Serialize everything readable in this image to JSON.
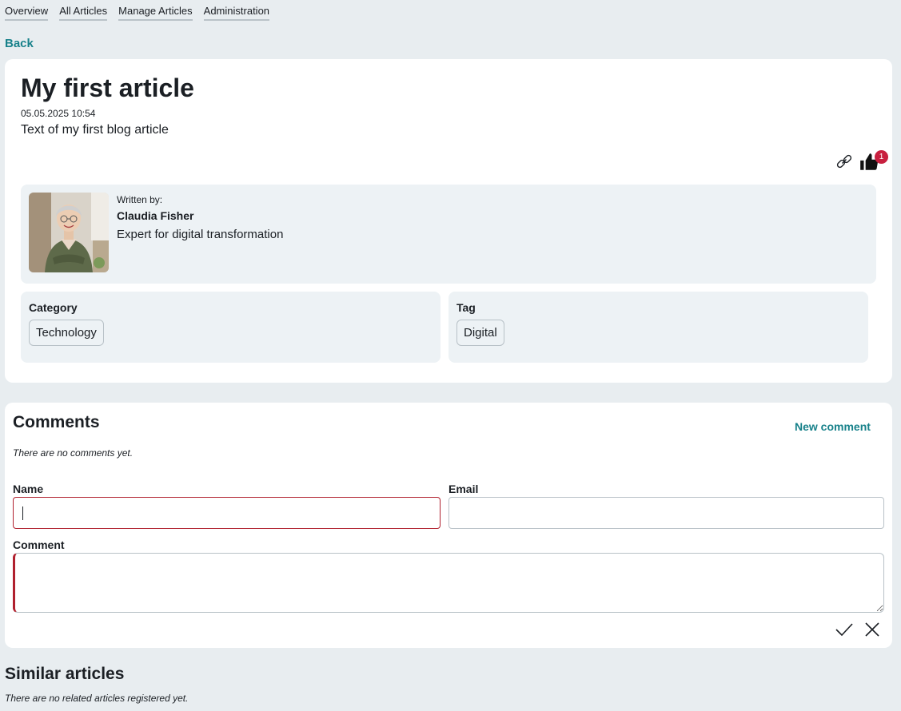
{
  "nav": {
    "items": [
      {
        "label": "Overview"
      },
      {
        "label": "All Articles"
      },
      {
        "label": "Manage Articles"
      },
      {
        "label": "Administration"
      }
    ],
    "back_label": "Back"
  },
  "article": {
    "title": "My first article",
    "date": "05.05.2025 10:54",
    "text": "Text of my first blog article",
    "likes_count": "1",
    "icons": {
      "share": "link-icon",
      "like": "thumbs-up-icon"
    }
  },
  "author": {
    "written_by_label": "Written by:",
    "name": "Claudia Fisher",
    "role": "Expert for digital transformation"
  },
  "category": {
    "label": "Category",
    "value": "Technology"
  },
  "tag": {
    "label": "Tag",
    "value": "Digital"
  },
  "comments": {
    "title": "Comments",
    "new_comment_label": "New comment",
    "empty_text": "There are no comments yet.",
    "form": {
      "name_label": "Name",
      "name_value": "",
      "email_label": "Email",
      "email_value": "",
      "comment_label": "Comment",
      "comment_value": ""
    },
    "icons": {
      "confirm": "checkmark-icon",
      "cancel": "close-icon"
    }
  },
  "similar": {
    "title": "Similar articles",
    "empty_text": "There are no related articles registered yet."
  },
  "colors": {
    "accent": "#17818a",
    "badge": "#c8203f",
    "error_border": "#b0202e",
    "background": "#e8edf0",
    "panel": "#edf2f5"
  }
}
